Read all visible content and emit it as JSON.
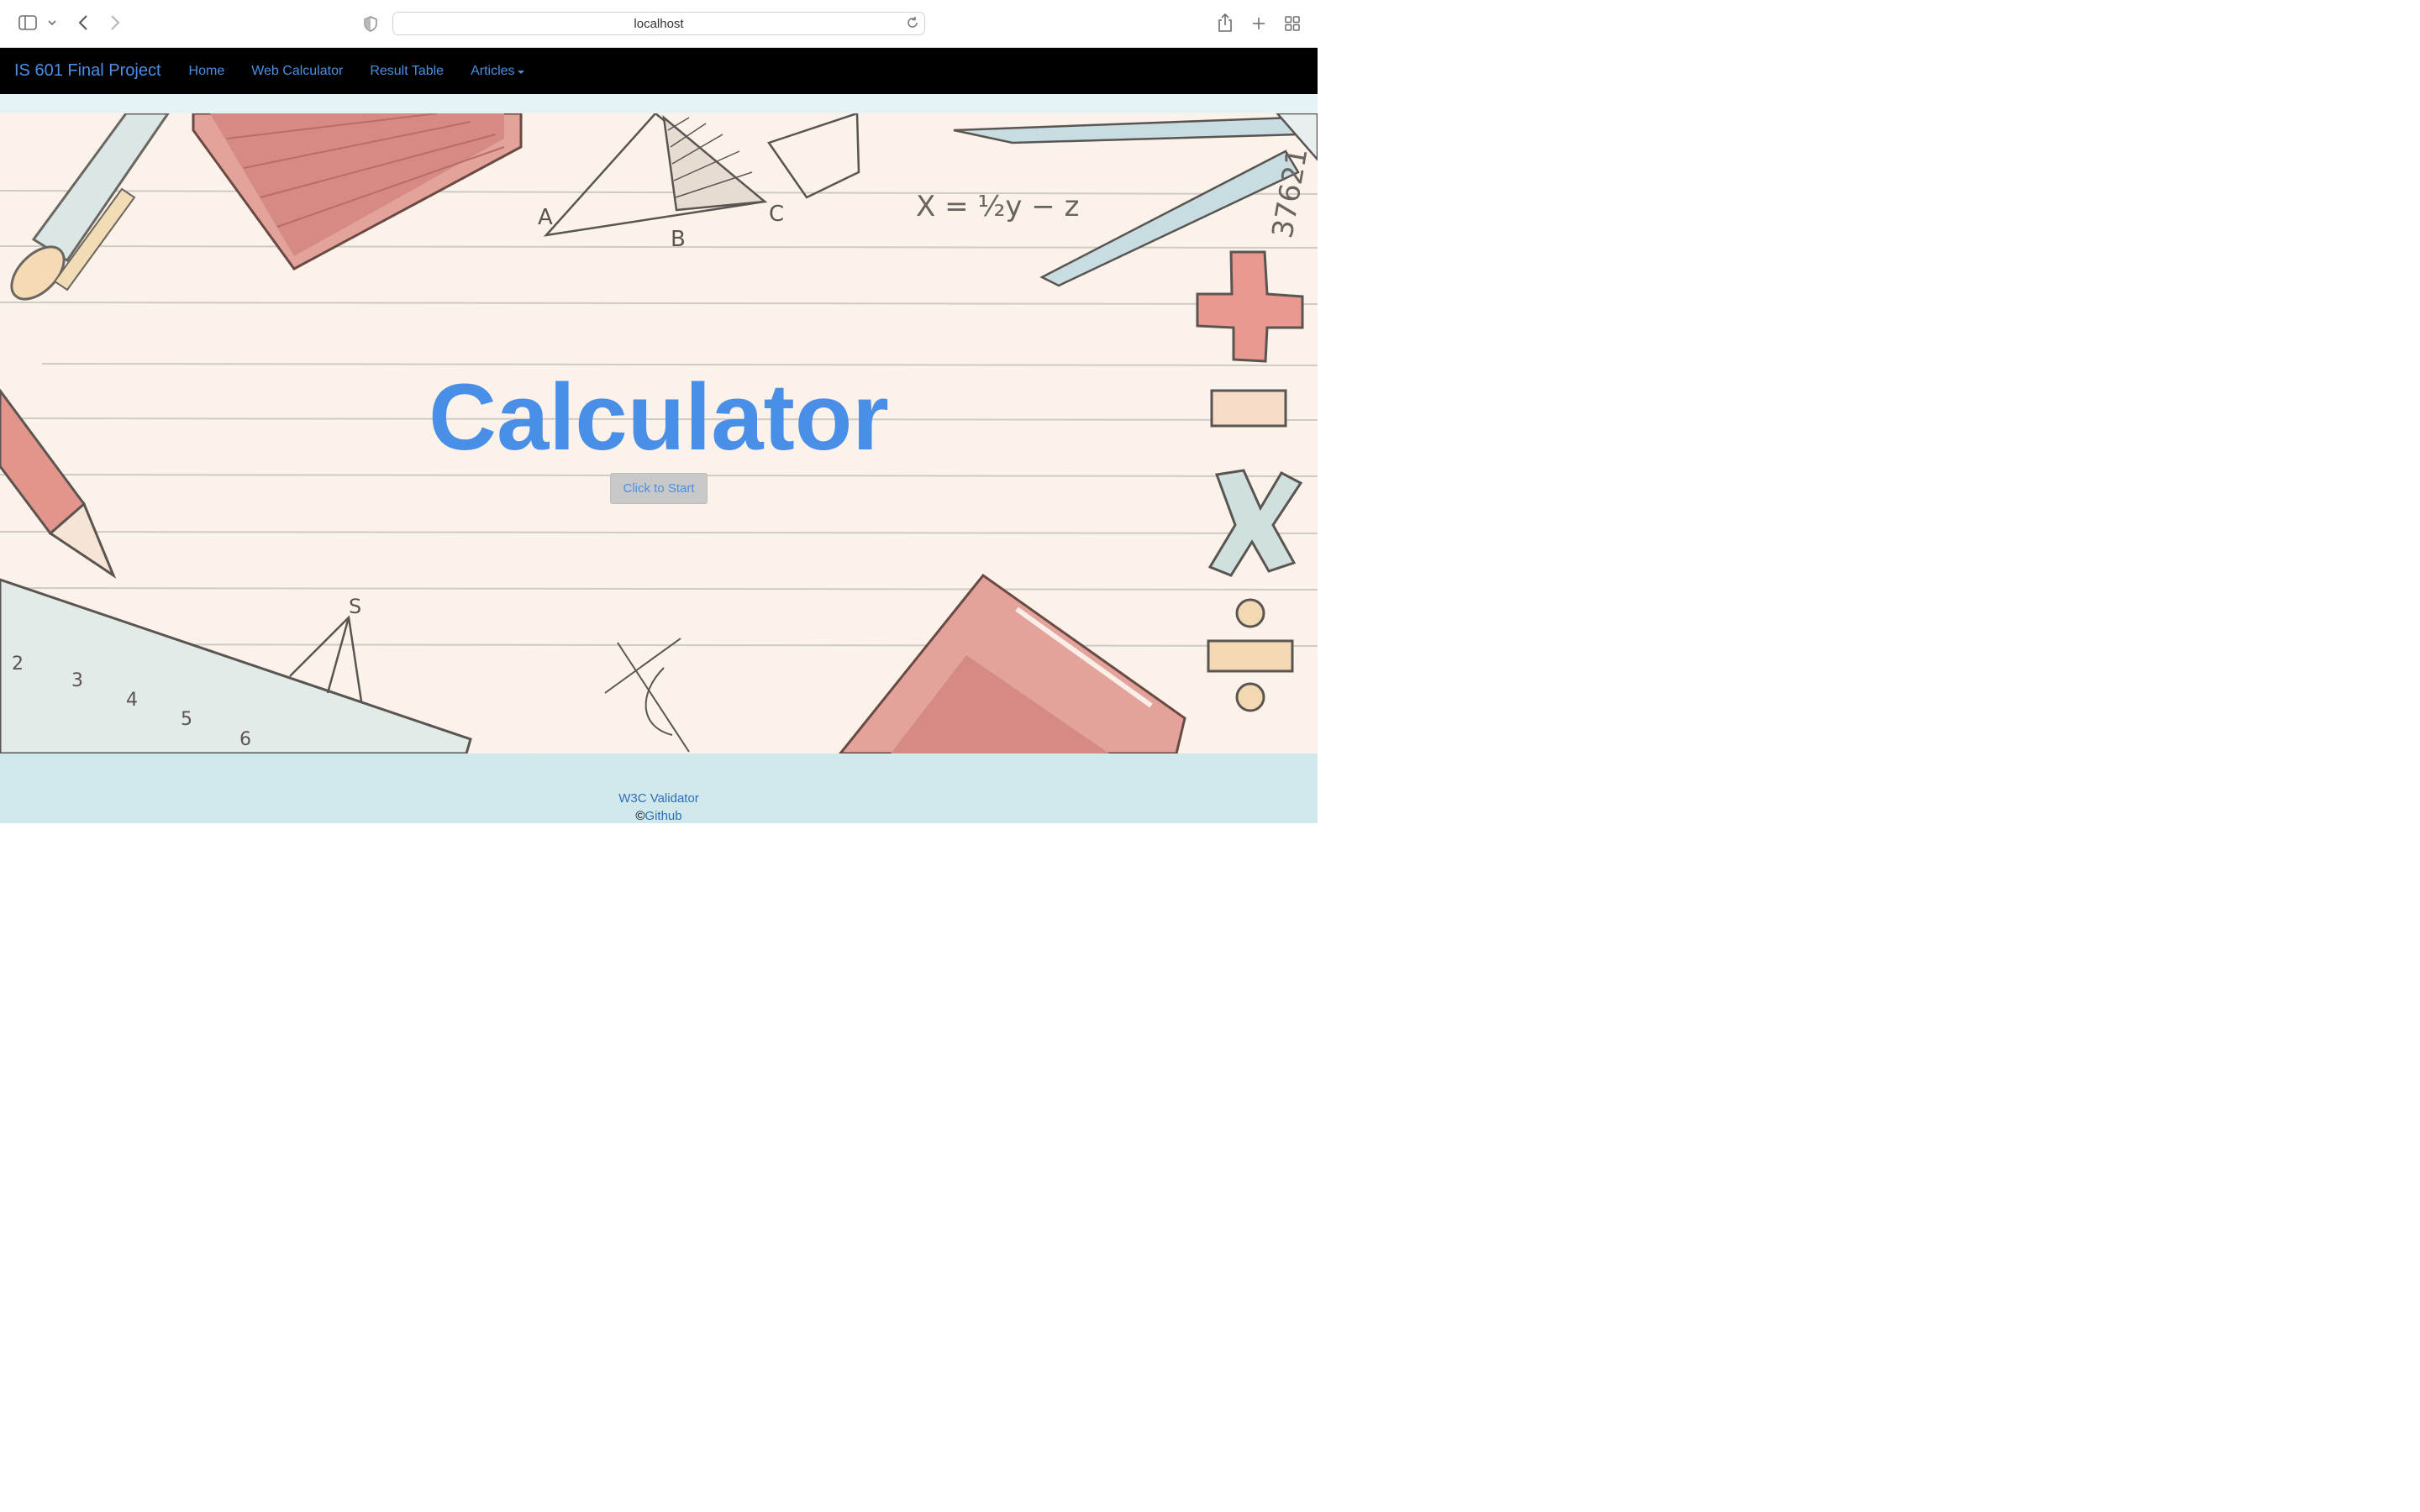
{
  "browser": {
    "url": "localhost",
    "icons": [
      "sidebar-icon",
      "chevron-down-icon",
      "back-icon",
      "forward-icon",
      "shield-icon",
      "reload-icon",
      "share-icon",
      "new-tab-icon",
      "tab-overview-icon"
    ]
  },
  "navbar": {
    "brand": "IS 601 Final Project",
    "links": [
      {
        "label": "Home"
      },
      {
        "label": "Web Calculator"
      },
      {
        "label": "Result Table"
      },
      {
        "label": "Articles"
      }
    ]
  },
  "hero": {
    "title": "Calculator",
    "button_label": "Click to Start"
  },
  "footer": {
    "validator_label": "W3C Validator",
    "copyright_symbol": "©",
    "github_label": "Github"
  },
  "colors": {
    "accent": "#4a8fe7",
    "navbar_bg": "#000000",
    "hero_bg": "#fbf2e9",
    "button_bg": "#c8c8c8"
  }
}
